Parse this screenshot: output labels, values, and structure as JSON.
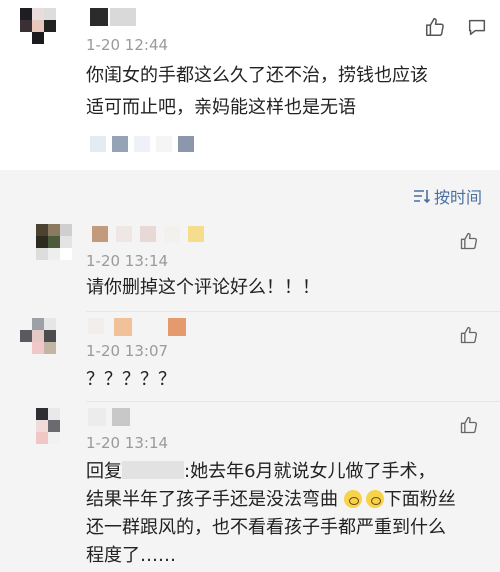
{
  "colors": {
    "link_blue": "#4a6fa0",
    "meta_gray": "#9a9a9a",
    "text": "#222222"
  },
  "main_comment": {
    "timestamp": "1-20 12:44",
    "text_line1": "你闺女的手都这么久了还不治，捞钱也应该",
    "text_line2": "适可而止吧，亲妈能这样也是无语",
    "like_icon": "thumbs-up-icon",
    "share_icon": "share-icon"
  },
  "sort": {
    "icon": "sort-icon",
    "label": "按时间"
  },
  "replies": [
    {
      "timestamp": "1-20 13:14",
      "text": "请你删掉这个评论好么！！！",
      "like_icon": "thumbs-up-icon"
    },
    {
      "timestamp": "1-20 13:07",
      "text": "？？？？？",
      "like_icon": "thumbs-up-icon"
    },
    {
      "timestamp": "1-20 13:14",
      "reply_prefix": "回复",
      "text_line1_rest": ":她去年6月就说女儿做了手术，",
      "text_line2a": "结果半年了孩子手还是没法弯曲",
      "text_line2b": "下面粉丝",
      "text_line3": "还一群跟风的，也不看看孩子手都严重到什么",
      "text_line4": "程度了……",
      "like_icon": "thumbs-up-icon"
    }
  ]
}
